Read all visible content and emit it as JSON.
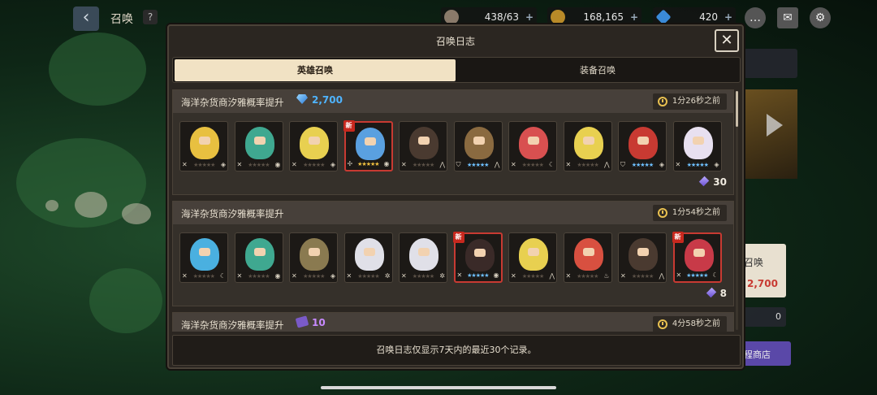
{
  "background": {
    "screen_title": "召唤",
    "help_label": "?",
    "back_icon": "chevron-left-icon",
    "resources": [
      {
        "name": "stamina",
        "value": "438/63",
        "icon": "coffee-icon"
      },
      {
        "name": "gold",
        "value": "168,165",
        "icon": "gold-coin-icon"
      },
      {
        "name": "gems",
        "value": "420",
        "icon": "gem-icon"
      }
    ],
    "side_label": "召唤",
    "side_cost": "2,700",
    "side_count": "0",
    "side_shop": "程商店"
  },
  "modal": {
    "title": "召唤日志",
    "close_label": "✕",
    "tabs": [
      {
        "label": "英雄召唤",
        "active": true
      },
      {
        "label": "装备召唤",
        "active": false
      }
    ],
    "footer_note": "召唤日志仅显示7天内的最近30个记录。"
  },
  "entries": [
    {
      "title": "海洋杂货商汐雅概率提升",
      "cost_type": "diamond",
      "cost": "2,700",
      "time": "1分26秒之前",
      "result_count": "30",
      "heroes": [
        {
          "color": "#e8c040",
          "new": false,
          "role": "✕",
          "elem": "◈",
          "stars": "★★★★★",
          "tier": "dim"
        },
        {
          "color": "#3fa890",
          "new": false,
          "role": "✕",
          "elem": "◉",
          "stars": "★★★★★",
          "tier": "dim"
        },
        {
          "color": "#e8d050",
          "new": false,
          "role": "✕",
          "elem": "◈",
          "stars": "★★★★★",
          "tier": "dim"
        },
        {
          "color": "#5aa0e0",
          "new": true,
          "role": "✢",
          "elem": "◉",
          "stars": "★★★★★",
          "tier": "gold"
        },
        {
          "color": "#4a3a30",
          "new": false,
          "role": "✕",
          "elem": "⋀",
          "stars": "★★★★★",
          "tier": "dim"
        },
        {
          "color": "#8a6a40",
          "new": false,
          "role": "⛉",
          "elem": "⋀",
          "stars": "★★★★★",
          "tier": "lit"
        },
        {
          "color": "#d85050",
          "new": false,
          "role": "✕",
          "elem": "☾",
          "stars": "★★★★★",
          "tier": "dim"
        },
        {
          "color": "#e8d050",
          "new": false,
          "role": "✕",
          "elem": "⋀",
          "stars": "★★★★★",
          "tier": "dim"
        },
        {
          "color": "#c83a32",
          "new": false,
          "role": "⛉",
          "elem": "◈",
          "stars": "★★★★★",
          "tier": "lit"
        },
        {
          "color": "#e8e0f0",
          "new": false,
          "role": "✕",
          "elem": "◈",
          "stars": "★★★★★",
          "tier": "lit"
        }
      ]
    },
    {
      "title": "海洋杂货商汐雅概率提升",
      "cost_type": "none",
      "cost": "",
      "time": "1分54秒之前",
      "result_count": "8",
      "heroes": [
        {
          "color": "#4ab0e0",
          "new": false,
          "role": "✕",
          "elem": "☾",
          "stars": "★★★★★",
          "tier": "dim"
        },
        {
          "color": "#3fa890",
          "new": false,
          "role": "✕",
          "elem": "◉",
          "stars": "★★★★★",
          "tier": "dim"
        },
        {
          "color": "#8a7a50",
          "new": false,
          "role": "✕",
          "elem": "◈",
          "stars": "★★★★★",
          "tier": "dim"
        },
        {
          "color": "#e0e0e8",
          "new": false,
          "role": "✕",
          "elem": "✲",
          "stars": "★★★★★",
          "tier": "dim"
        },
        {
          "color": "#e0e0e8",
          "new": false,
          "role": "✕",
          "elem": "✲",
          "stars": "★★★★★",
          "tier": "dim"
        },
        {
          "color": "#3a2a28",
          "new": true,
          "role": "✕",
          "elem": "◉",
          "stars": "★★★★★",
          "tier": "lit"
        },
        {
          "color": "#e8d050",
          "new": false,
          "role": "✕",
          "elem": "⋀",
          "stars": "★★★★★",
          "tier": "dim"
        },
        {
          "color": "#d85040",
          "new": false,
          "role": "✕",
          "elem": "♨",
          "stars": "★★★★★",
          "tier": "dim"
        },
        {
          "color": "#4a3a30",
          "new": false,
          "role": "✕",
          "elem": "⋀",
          "stars": "★★★★★",
          "tier": "dim"
        },
        {
          "color": "#c83a48",
          "new": true,
          "role": "✕",
          "elem": "☾",
          "stars": "★★★★★",
          "tier": "lit"
        }
      ]
    },
    {
      "title": "海洋杂货商汐雅概率提升",
      "cost_type": "ticket",
      "cost": "10",
      "time": "4分58秒之前",
      "result_count": "",
      "heroes": []
    }
  ]
}
